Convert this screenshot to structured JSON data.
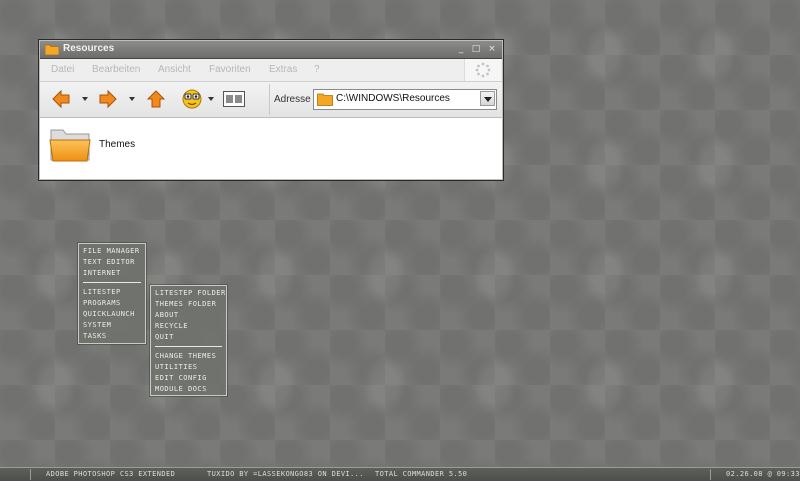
{
  "window": {
    "title": "Resources",
    "buttons": {
      "minimize": "_",
      "maximize": "□",
      "close": "×"
    },
    "menu": [
      "Datei",
      "Bearbeiten",
      "Ansicht",
      "Favoriten",
      "Extras",
      "?"
    ],
    "toolbar": {
      "back_icon": "arrow-left-icon",
      "forward_icon": "arrow-right-icon",
      "up_icon": "arrow-up-icon",
      "search_icon": "smiley-search-icon",
      "views_icon": "views-icon"
    },
    "address": {
      "label": "Adresse",
      "value": "C:\\WINDOWS\\Resources"
    },
    "files": [
      {
        "name": "Themes",
        "icon": "folder-icon"
      }
    ]
  },
  "menu_main": {
    "group1": [
      "FILE MANAGER",
      "TEXT EDITOR",
      "INTERNET"
    ],
    "group2": [
      "LITESTEP",
      "PROGRAMS",
      "QUICKLAUNCH",
      "SYSTEM",
      "TASKS"
    ]
  },
  "menu_sub": {
    "group1": [
      "LITESTEP FOLDER",
      "THEMES FOLDER",
      "ABOUT",
      "RECYCLE",
      "QUIT"
    ],
    "group2": [
      "CHANGE THEMES",
      "UTILITIES",
      "EDIT CONFIG",
      "MODULE DOCS"
    ]
  },
  "taskbar": {
    "tasks": [
      "ADOBE PHOTOSHOP CS3 EXTENDED",
      "TUXIDO BY =LASSEKONGO83 ON DEVI...",
      "TOTAL COMMANDER 5.50"
    ],
    "clock": "02.26.08 @ 09:33"
  },
  "colors": {
    "accent_orange": "#f08a1c",
    "folder": "#f5a623",
    "menu_bg": "#6e726c"
  }
}
